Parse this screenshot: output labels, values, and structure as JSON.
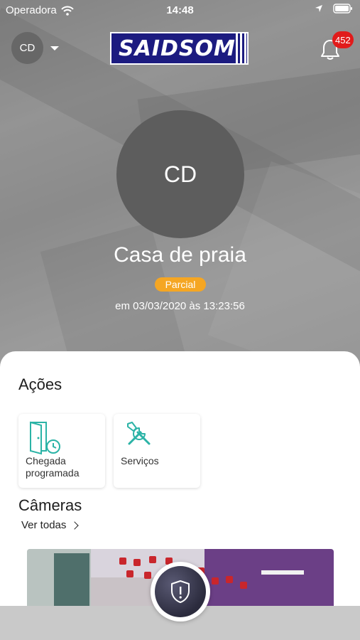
{
  "status_bar": {
    "carrier": "Operadora",
    "time": "14:48"
  },
  "header": {
    "profile_initials": "CD",
    "logo_text": "SAIDSOM",
    "notifications_count": "452"
  },
  "property": {
    "initials": "CD",
    "name": "Casa de praia",
    "state": "Parcial",
    "timestamp": "em 03/03/2020 às 13:23:56"
  },
  "actions": {
    "title": "Ações",
    "items": [
      {
        "label_line1": "Chegada",
        "label_line2": "programada",
        "icon": "door-clock-icon"
      },
      {
        "label": "Serviços",
        "icon": "tools-icon"
      }
    ]
  },
  "cameras": {
    "title": "Câmeras",
    "see_all": "Ver todas"
  },
  "colors": {
    "accent": "#2bb3a6",
    "state": "#f5a623",
    "badge": "#e11b1b",
    "logo_bg": "#1c1b80"
  }
}
